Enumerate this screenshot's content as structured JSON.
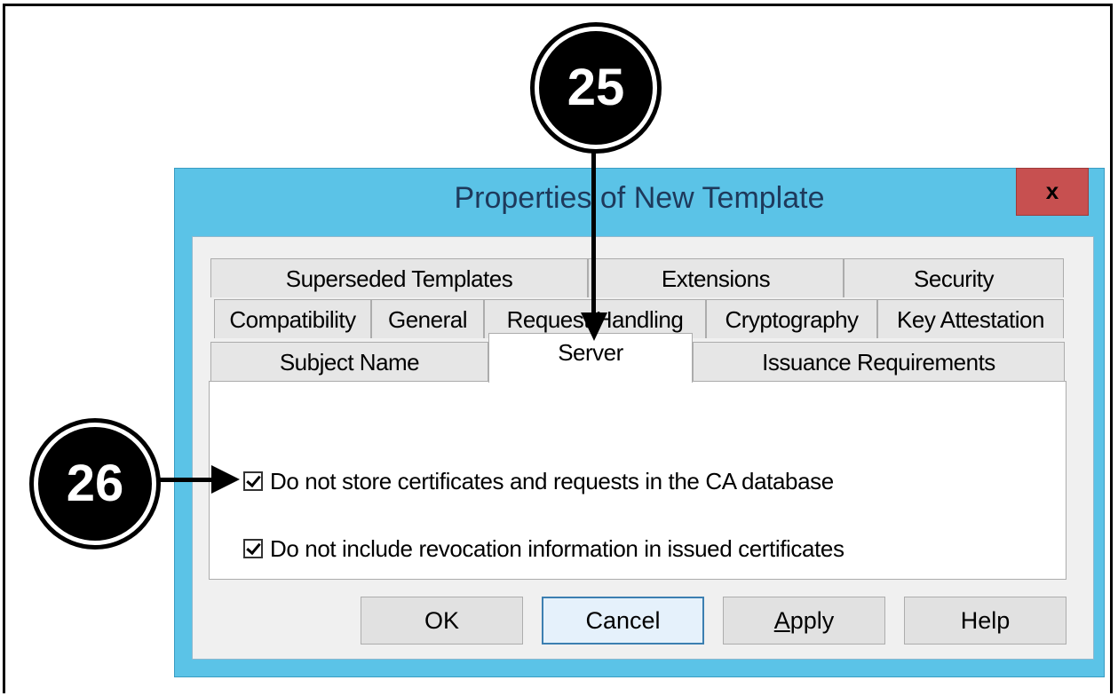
{
  "dialog": {
    "title": "Properties of New Template",
    "close_label": "x"
  },
  "tabs": {
    "row1": [
      "Superseded Templates",
      "Extensions",
      "Security"
    ],
    "row2": [
      "Compatibility",
      "General",
      "Request Handling",
      "Cryptography",
      "Key Attestation"
    ],
    "row3": [
      "Subject Name",
      "Server",
      "Issuance Requirements"
    ],
    "active": "Server"
  },
  "options": [
    {
      "label": "Do not store certificates and requests in the CA database",
      "checked": true
    },
    {
      "label": "Do not include revocation information in issued certificates",
      "checked": true
    }
  ],
  "buttons": {
    "ok": "OK",
    "cancel": "Cancel",
    "apply_first": "A",
    "apply_rest": "pply",
    "help": "Help"
  },
  "callouts": {
    "step_25": "25",
    "step_26": "26"
  },
  "colors": {
    "title_bar": "#5bc3e7",
    "close_button": "#c75050",
    "title_text": "#1e395b"
  }
}
